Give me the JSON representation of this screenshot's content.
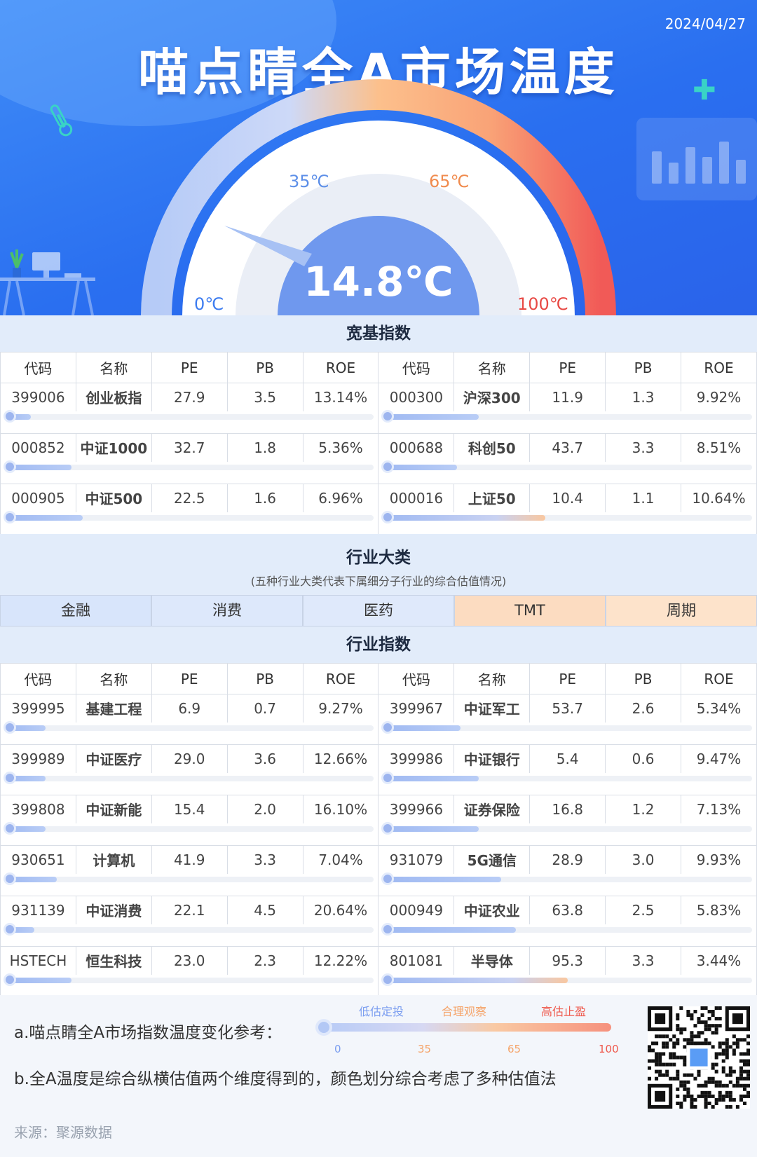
{
  "header": {
    "date": "2024/04/27",
    "title": "喵点睛全A市场温度",
    "temperature": "14.8℃",
    "temperature_value": 14.8,
    "gauge_labels": {
      "zero": "0℃",
      "low": "35℃",
      "mid": "65℃",
      "high": "100℃"
    }
  },
  "broad_index": {
    "title": "宽基指数",
    "headers": [
      "代码",
      "名称",
      "PE",
      "PB",
      "ROE"
    ],
    "rows": [
      {
        "left": {
          "code": "399006",
          "name": "创业板指",
          "pe": "27.9",
          "pb": "3.5",
          "roe": "13.14%",
          "temp": 7
        },
        "right": {
          "code": "000300",
          "name": "沪深300",
          "pe": "11.9",
          "pb": "1.3",
          "roe": "9.92%",
          "temp": 26
        }
      },
      {
        "left": {
          "code": "000852",
          "name": "中证1000",
          "pe": "32.7",
          "pb": "1.8",
          "roe": "5.36%",
          "temp": 18
        },
        "right": {
          "code": "000688",
          "name": "科创50",
          "pe": "43.7",
          "pb": "3.3",
          "roe": "8.51%",
          "temp": 20
        }
      },
      {
        "left": {
          "code": "000905",
          "name": "中证500",
          "pe": "22.5",
          "pb": "1.6",
          "roe": "6.96%",
          "temp": 21
        },
        "right": {
          "code": "000016",
          "name": "上证50",
          "pe": "10.4",
          "pb": "1.1",
          "roe": "10.64%",
          "temp": 44,
          "warm": true
        }
      }
    ]
  },
  "industry_categories": {
    "title": "行业大类",
    "subtitle": "(五种行业大类代表下属细分子行业的综合估值情况)",
    "items": [
      {
        "label": "金融",
        "color": "#d8e5fb"
      },
      {
        "label": "消费",
        "color": "#dde8fb"
      },
      {
        "label": "医药",
        "color": "#dfe9fb"
      },
      {
        "label": "TMT",
        "color": "#fcdcc1"
      },
      {
        "label": "周期",
        "color": "#fde3cb"
      }
    ]
  },
  "industry_index": {
    "title": "行业指数",
    "headers": [
      "代码",
      "名称",
      "PE",
      "PB",
      "ROE"
    ],
    "rows": [
      {
        "left": {
          "code": "399995",
          "name": "基建工程",
          "pe": "6.9",
          "pb": "0.7",
          "roe": "9.27%",
          "temp": 11
        },
        "right": {
          "code": "399967",
          "name": "中证军工",
          "pe": "53.7",
          "pb": "2.6",
          "roe": "5.34%",
          "temp": 21
        }
      },
      {
        "left": {
          "code": "399989",
          "name": "中证医疗",
          "pe": "29.0",
          "pb": "3.6",
          "roe": "12.66%",
          "temp": 11
        },
        "right": {
          "code": "399986",
          "name": "中证银行",
          "pe": "5.4",
          "pb": "0.6",
          "roe": "9.47%",
          "temp": 26
        }
      },
      {
        "left": {
          "code": "399808",
          "name": "中证新能",
          "pe": "15.4",
          "pb": "2.0",
          "roe": "16.10%",
          "temp": 11
        },
        "right": {
          "code": "399966",
          "name": "证券保险",
          "pe": "16.8",
          "pb": "1.2",
          "roe": "7.13%",
          "temp": 26
        }
      },
      {
        "left": {
          "code": "930651",
          "name": "计算机",
          "pe": "41.9",
          "pb": "3.3",
          "roe": "7.04%",
          "temp": 14
        },
        "right": {
          "code": "931079",
          "name": "5G通信",
          "pe": "28.9",
          "pb": "3.0",
          "roe": "9.93%",
          "temp": 32
        }
      },
      {
        "left": {
          "code": "931139",
          "name": "中证消费",
          "pe": "22.1",
          "pb": "4.5",
          "roe": "20.64%",
          "temp": 8
        },
        "right": {
          "code": "000949",
          "name": "中证农业",
          "pe": "63.8",
          "pb": "2.5",
          "roe": "5.83%",
          "temp": 36
        }
      },
      {
        "left": {
          "code": "HSTECH",
          "name": "恒生科技",
          "pe": "23.0",
          "pb": "2.3",
          "roe": "12.22%",
          "temp": 18
        },
        "right": {
          "code": "801081",
          "name": "半导体",
          "pe": "95.3",
          "pb": "3.3",
          "roe": "3.44%",
          "temp": 50,
          "warm": true
        }
      }
    ]
  },
  "footer": {
    "note_a": "a.喵点睛全A市场指数温度变化参考：",
    "note_b": "b.全A温度是综合纵横估值两个维度得到的，颜色划分综合考虑了多种估值法",
    "legend": {
      "low": "低估定投",
      "mid": "合理观察",
      "high": "高估止盈",
      "ticks": [
        "0",
        "35",
        "65",
        "100"
      ]
    },
    "source": "来源：聚源数据",
    "colors": {
      "low": "#7a9df0",
      "mid": "#f5a46a",
      "high": "#ef5a4e"
    }
  }
}
